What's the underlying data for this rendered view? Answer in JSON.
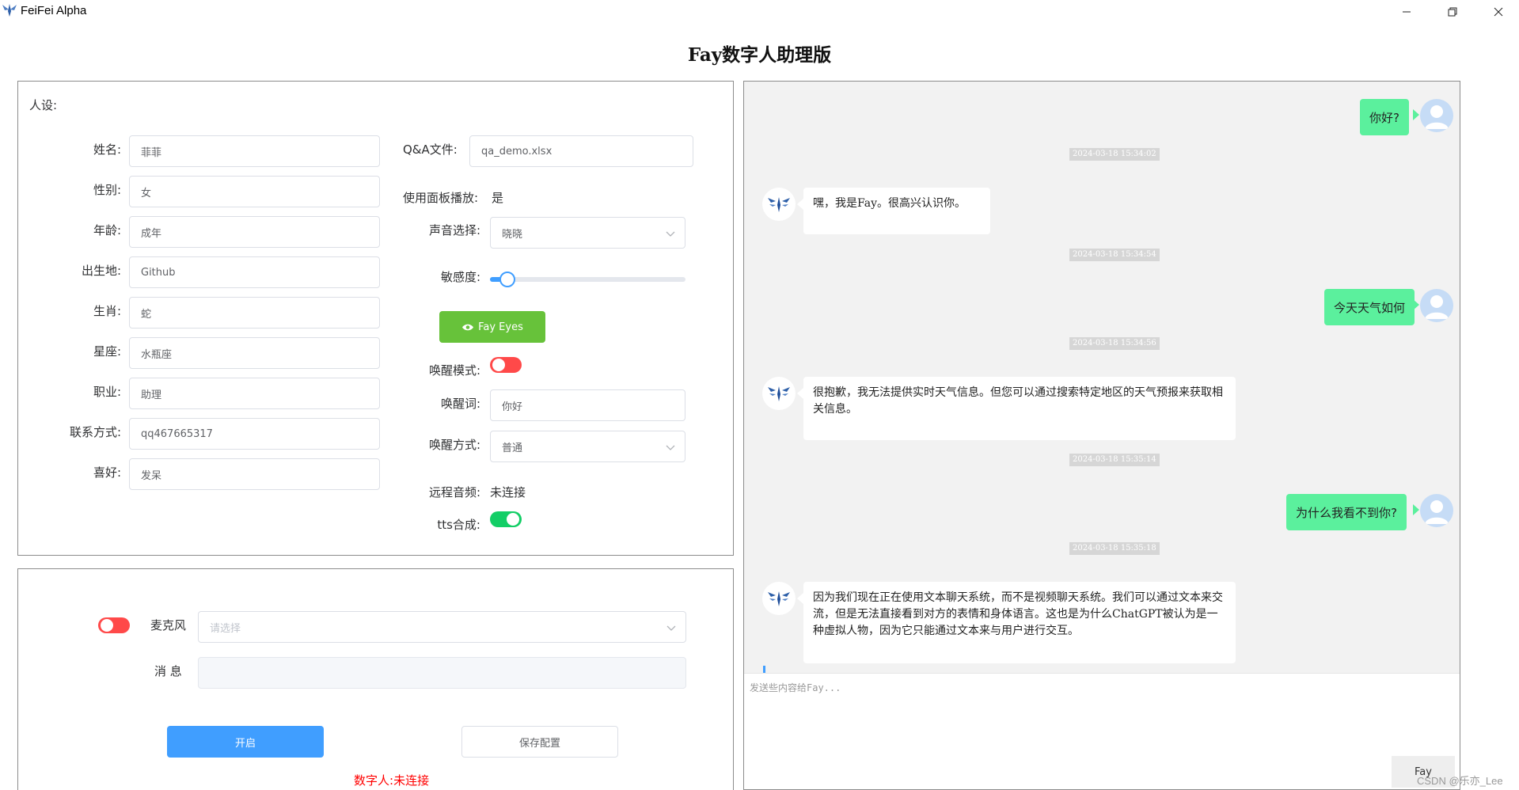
{
  "app": {
    "title": "FeiFei Alpha",
    "logo_icon": "fay-logo-icon"
  },
  "window_controls": {
    "minimize": "minimize-icon",
    "restore": "restore-icon",
    "close": "close-icon"
  },
  "page": {
    "title": "Fay数字人助理版"
  },
  "persona": {
    "heading": "人设:",
    "fields": [
      {
        "label": "姓名:",
        "value": "菲菲"
      },
      {
        "label": "性别:",
        "value": "女"
      },
      {
        "label": "年龄:",
        "value": "成年"
      },
      {
        "label": "出生地:",
        "value": "Github"
      },
      {
        "label": "生肖:",
        "value": "蛇"
      },
      {
        "label": "星座:",
        "value": "水瓶座"
      },
      {
        "label": "职业:",
        "value": "助理"
      },
      {
        "label": "联系方式:",
        "value": "qq467665317"
      },
      {
        "label": "喜好:",
        "value": "发呆"
      }
    ]
  },
  "config": {
    "qa_file": {
      "label": "Q&A文件:",
      "value": "qa_demo.xlsx"
    },
    "panel_play": {
      "label": "使用面板播放:",
      "value": "是"
    },
    "voice": {
      "label": "声音选择:",
      "value": "晓晓"
    },
    "sensitivity": {
      "label": "敏感度:",
      "value": 0.08
    },
    "fay_eyes": {
      "label": "Fay Eyes",
      "icon": "eye-icon"
    },
    "wake_mode": {
      "label": "唤醒模式:",
      "on": false
    },
    "wake_word": {
      "label": "唤醒词:",
      "value": "你好"
    },
    "wake_method": {
      "label": "唤醒方式:",
      "value": "普通"
    },
    "remote_audio": {
      "label": "远程音频:",
      "value": "未连接"
    },
    "tts": {
      "label": "tts合成:",
      "on": true
    }
  },
  "control": {
    "mic": {
      "label": "麦克风",
      "placeholder": "请选择",
      "on": false
    },
    "message": {
      "label": "消 息",
      "value": ""
    },
    "start_label": "开启",
    "save_label": "保存配置",
    "status_label": "数字人:",
    "status_value": "未连接"
  },
  "chat": {
    "messages": [
      {
        "role": "user",
        "text": "你好?"
      },
      {
        "role": "time",
        "text": "2024-03-18 15:34:02"
      },
      {
        "role": "bot",
        "text": "嘿，我是Fay。很高兴认识你。"
      },
      {
        "role": "time",
        "text": "2024-03-18 15:34:54"
      },
      {
        "role": "user",
        "text": "今天天气如何"
      },
      {
        "role": "time",
        "text": "2024-03-18 15:34:56"
      },
      {
        "role": "bot",
        "text": "很抱歉，我无法提供实时天气信息。但您可以通过搜索特定地区的天气预报来获取相关信息。"
      },
      {
        "role": "time",
        "text": "2024-03-18 15:35:14"
      },
      {
        "role": "user",
        "text": "为什么我看不到你?"
      },
      {
        "role": "time",
        "text": "2024-03-18 15:35:18"
      },
      {
        "role": "bot",
        "text": "因为我们现在正在使用文本聊天系统，而不是视频聊天系统。我们可以通过文本来交流，但是无法直接看到对方的表情和身体语言。这也是为什么ChatGPT被认为是一种虚拟人物，因为它只能通过文本来与用户进行交互。"
      }
    ],
    "input_placeholder": "发送些内容给Fay...",
    "send_label": "Fay"
  },
  "watermark": "CSDN @乐亦_Lee",
  "colors": {
    "accent": "#409eff",
    "user_bubble": "#5bf09d",
    "switch_on": "#13ce66",
    "switch_off": "#ff4949",
    "fay_eyes": "#67c23a",
    "status_red": "#ff0000"
  }
}
